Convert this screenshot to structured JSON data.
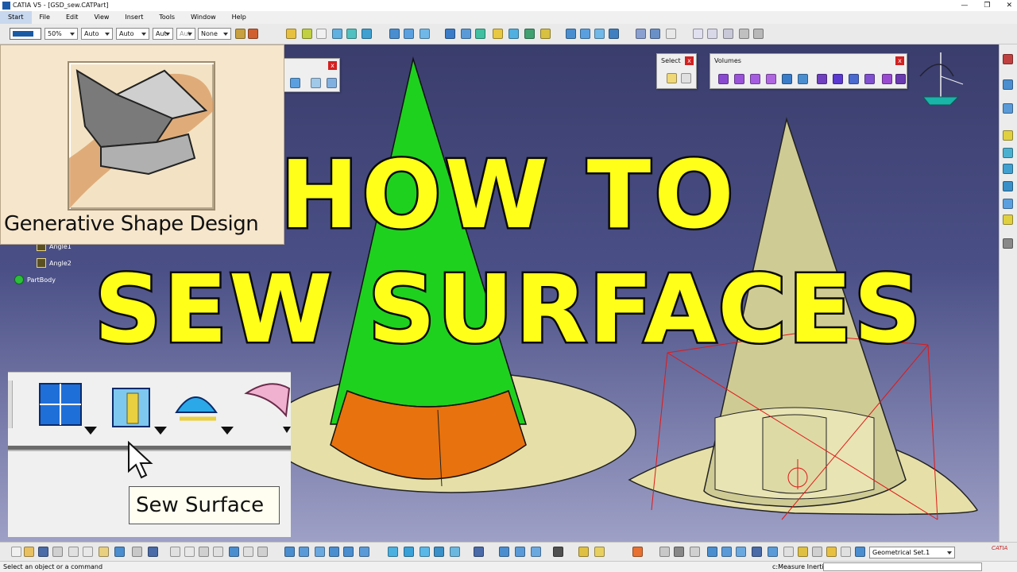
{
  "window": {
    "title": "CATIA V5 - [GSD_sew.CATPart]",
    "controls": [
      "—",
      "❐",
      "✕"
    ]
  },
  "menu": [
    "Start",
    "File",
    "Edit",
    "View",
    "Insert",
    "Tools",
    "Window",
    "Help"
  ],
  "toolbar": {
    "zoom_combo": "50%",
    "auto1": "Auto",
    "auto2": "Auto",
    "auto3": "Aut",
    "auto4": "Aut",
    "layer": "None"
  },
  "panels": {
    "select_title": "Select",
    "volumes_title": "Volumes"
  },
  "workbench": {
    "name": "Generative Shape Design"
  },
  "tree": {
    "items": [
      "Angle1",
      "Angle2",
      "PartBody"
    ]
  },
  "tooltip": {
    "text": "Sew Surface"
  },
  "headline": {
    "line1": "HOW TO",
    "line2": "SEW SURFACES"
  },
  "bottom": {
    "geometrical_set": "Geometrical Set.1"
  },
  "status": {
    "message": "Select an object or a command",
    "command": "c:Measure Inertia"
  },
  "colors": {
    "accent_yellow": "#ffff1a",
    "cone_green": "#1fd11f",
    "cone_orange": "#e8720e",
    "surface_beige": "#e6e0a8",
    "viewport_top": "#3a3d6c"
  }
}
